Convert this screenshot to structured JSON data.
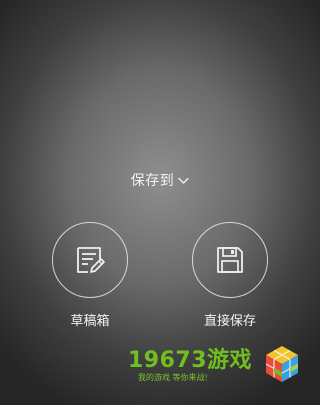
{
  "save_to": {
    "label": "保存到"
  },
  "actions": [
    {
      "label": "草稿箱",
      "icon": "edit-note-icon"
    },
    {
      "label": "直接保存",
      "icon": "floppy-disk-icon"
    }
  ],
  "watermark": {
    "name": "19673游戏",
    "slogan": "我的游戏  等你来战!",
    "color": "#6fbf1e"
  }
}
